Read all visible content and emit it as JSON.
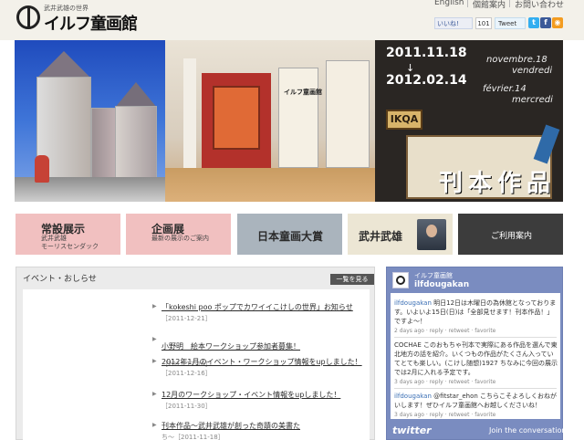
{
  "header": {
    "logo_subtitle": "武井武雄の世界",
    "logo_text": "イルフ童画館",
    "links": [
      "English",
      "個館案内",
      "お問い合わせ"
    ],
    "like_label": "いいね!",
    "like_count": "101",
    "tweet_label": "Tweet",
    "social_icons": [
      "twitter-icon",
      "facebook-icon",
      "rss-icon"
    ]
  },
  "hero": {
    "date_start": "2011.11.18",
    "date_end": "2012.02.14",
    "arrow": "↓",
    "start_month": "novembre.18",
    "start_day": "vendredi",
    "end_month": "février.14",
    "end_day": "mercredi",
    "sign": "IKQA",
    "kanji": "刊本作品",
    "museum_sign": "イルフ童画館"
  },
  "nav": [
    {
      "title": "常設展示",
      "sub1": "武井武雄",
      "sub2": "モーリスセンダック",
      "color": "#f1c0c0"
    },
    {
      "title": "企画展",
      "sub1": "最新の展示のご案内",
      "sub2": "",
      "color": "#f1c0c0"
    },
    {
      "title": "日本童画大賞",
      "color": "#aab4bd"
    },
    {
      "title": "武井武雄",
      "color": "#ece6d4"
    },
    {
      "title": "ご利用案内",
      "color": "#3c3c3c"
    }
  ],
  "news": {
    "title": "イベント・おしらせ",
    "more_label": "一覧を見る",
    "items": [
      {
        "title": "「kokeshi poo ポップでカワイイこけしの世界」お知らせ",
        "date": "［2011-12-21］"
      },
      {
        "title": "小野明　絵本ワークショップ参加者募集！",
        "date": "［2011-12-18］"
      },
      {
        "title": "2012年1月のイベント・ワークショップ情報をupしました！",
        "date": "［2011-12-16］"
      },
      {
        "title": "12月のワークショップ・イベント情報をupしました！",
        "date": "［2011-11-30］"
      },
      {
        "title": "刊本作品～武井武雄が創った奇蹟の美書た",
        "date": "ち～［2011-11-18］"
      }
    ]
  },
  "twitter": {
    "name": "イルフ童画館",
    "handle": "ilfdougakan",
    "tweets": [
      {
        "user": "ilfdougakan",
        "text": " 明日12日は木曜日の為休館となっております。いよいよ15日(日)は「全部見せます！刊本作品！」ですよ〜！",
        "meta": "2 days ago · reply · retweet · favorite"
      },
      {
        "user": "",
        "text": "COCHAE このおもちゃ刊本で実際にある作品を選んで東北地方の話を紹介。いくつもの作品がたくさん入っていてとても楽しい。(こけし随想)1927 ちなみに今回の展示では2月に入れる予定です。",
        "meta": "3 days ago · reply · retweet · favorite"
      },
      {
        "user": "ilfdougakan",
        "text": " @fitstar_ehon こちらこそよろしくおねがいします！ぜひイルフ童画館へお越しくださいね！",
        "meta": "3 days ago · reply · retweet · favorite"
      }
    ],
    "logo": "twitter",
    "join_label": "Join the conversation"
  }
}
